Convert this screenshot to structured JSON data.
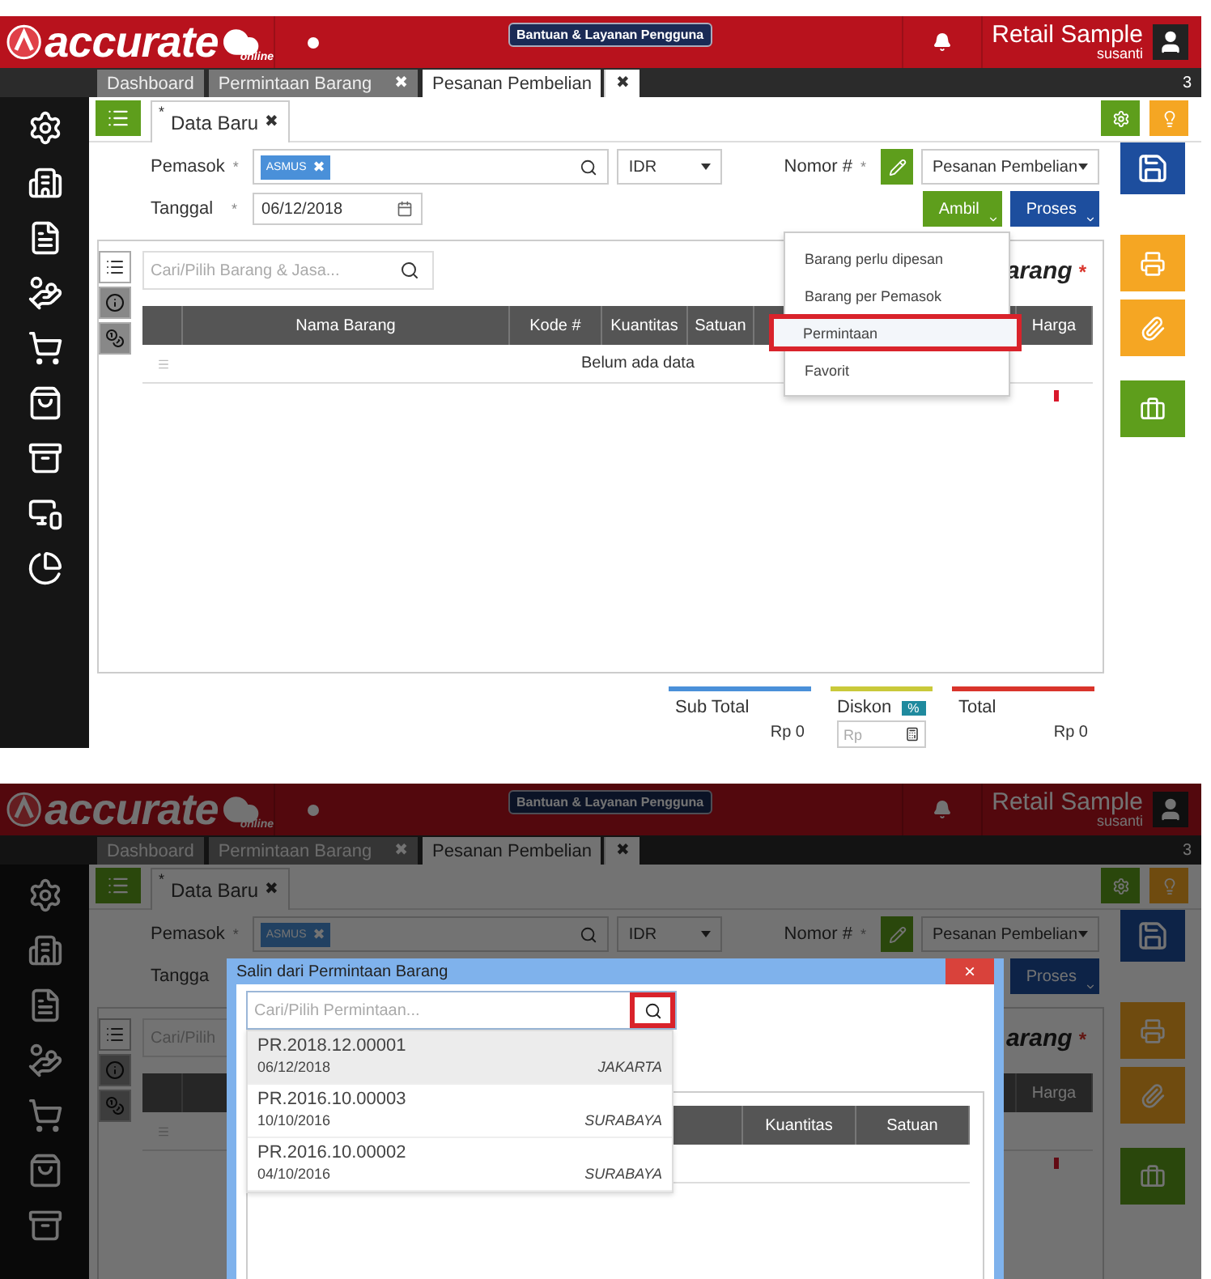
{
  "screens": [
    {
      "dimmed": false,
      "top_bar": {
        "logo": "accurate",
        "logo_sub": "online",
        "help": "Bantuan & Layanan Pengguna",
        "company": "Retail Sample",
        "user": "susanti"
      },
      "tabs": [
        {
          "label": "Dashboard",
          "selected": false
        },
        {
          "label": "Permintaan Barang",
          "close": "✖",
          "selected": false
        },
        {
          "label": "Pesanan Pembelian",
          "close": "✖",
          "selected": true
        }
      ],
      "tab_count": "3",
      "sidebar": [
        {
          "kind": "settings"
        },
        {
          "kind": "building"
        },
        {
          "kind": "document"
        },
        {
          "kind": "hand"
        },
        {
          "kind": "cart"
        },
        {
          "kind": "bag"
        },
        {
          "kind": "archive"
        },
        {
          "kind": "devices"
        },
        {
          "kind": "chart"
        }
      ],
      "doc_tab": {
        "mark": "*",
        "label": "Data Baru",
        "close": "✖"
      },
      "form": {
        "supplier_label": "Pemasok",
        "required": "*",
        "supplier_chip": "ASMUS",
        "chip_close": "✖",
        "currency": "IDR",
        "number_label": "Nomor #",
        "number_value": "Pesanan Pembelian",
        "date_label": "Tanggal",
        "date_value": "06/12/2018",
        "buttons": [
          {
            "label": "Ambil",
            "kind": "green"
          },
          {
            "label": "Proses",
            "kind": "blue"
          }
        ]
      },
      "panel": {
        "side_tabs": [
          {
            "kind": "list",
            "selected": true
          },
          {
            "kind": "info",
            "selected": false
          },
          {
            "kind": "coins",
            "selected": false
          }
        ],
        "search_placeholder": "Cari/Pilih Barang & Jasa...",
        "search_icon": true,
        "title": "arang",
        "required": "*",
        "columns": [
          "Nama Barang",
          "Kode #",
          "Kuantitas",
          "Satuan",
          "Harga"
        ],
        "empty_text": "Belum ada data"
      },
      "menu": [
        {
          "label": "Barang perlu dipesan",
          "highlighted": false
        },
        {
          "label": "Barang per Pemasok",
          "highlighted": false
        },
        {
          "label": "Permintaan",
          "highlighted": true
        },
        {
          "label": "Favorit",
          "highlighted": false
        }
      ],
      "summary": [
        {
          "kind": "value",
          "label": "Sub Total",
          "value": "Rp 0",
          "color": "#4a90d9"
        },
        {
          "kind": "input",
          "label": "Diskon",
          "badge": "%",
          "placeholder": "Rp",
          "color": "#c9c93a"
        },
        {
          "kind": "value",
          "label": "Total",
          "value": "Rp 0",
          "color": "#d9342b"
        }
      ]
    },
    {
      "dimmed": true,
      "top_bar": {
        "logo": "accurate",
        "logo_sub": "online",
        "help": "Bantuan & Layanan Pengguna",
        "company": "Retail Sample",
        "user": "susanti"
      },
      "tabs": [
        {
          "label": "Dashboard",
          "selected": false
        },
        {
          "label": "Permintaan Barang",
          "close": "✖",
          "selected": false
        },
        {
          "label": "Pesanan Pembelian",
          "close": "✖",
          "selected": true
        }
      ],
      "tab_count": "3",
      "sidebar": [
        {
          "kind": "settings"
        },
        {
          "kind": "building"
        },
        {
          "kind": "document"
        },
        {
          "kind": "hand"
        },
        {
          "kind": "cart"
        },
        {
          "kind": "bag"
        },
        {
          "kind": "archive"
        }
      ],
      "doc_tab": {
        "mark": "*",
        "label": "Data Baru",
        "close": "✖"
      },
      "form": {
        "supplier_label": "Pemasok",
        "required": "*",
        "supplier_chip": "ASMUS",
        "chip_close": "✖",
        "currency": "IDR",
        "number_label": "Nomor #",
        "number_value": "Pesanan Pembelian",
        "date_label": "Tangga",
        "buttons": [
          {
            "label": "Proses",
            "kind": "blue"
          }
        ]
      },
      "panel": {
        "side_tabs": [
          {
            "kind": "list",
            "selected": true
          },
          {
            "kind": "info",
            "selected": false
          },
          {
            "kind": "coins",
            "selected": false
          }
        ],
        "search_placeholder": "Cari/Pilih",
        "title": "arang",
        "required": "*",
        "columns": [
          "Harga"
        ]
      },
      "dialog": {
        "title": "Salin dari Permintaan Barang",
        "close": "×",
        "search_placeholder": "Cari/Pilih Permintaan...",
        "search_highlighted": true,
        "results": [
          {
            "number": "PR.2018.12.00001",
            "date": "06/12/2018",
            "city": "JAKARTA",
            "selected": true
          },
          {
            "number": "PR.2016.10.00003",
            "date": "10/10/2016",
            "city": "SURABAYA",
            "selected": false
          },
          {
            "number": "PR.2016.10.00002",
            "date": "04/10/2016",
            "city": "SURABAYA",
            "selected": false
          }
        ],
        "columns": [
          "Kuantitas",
          "Satuan"
        ]
      }
    }
  ]
}
